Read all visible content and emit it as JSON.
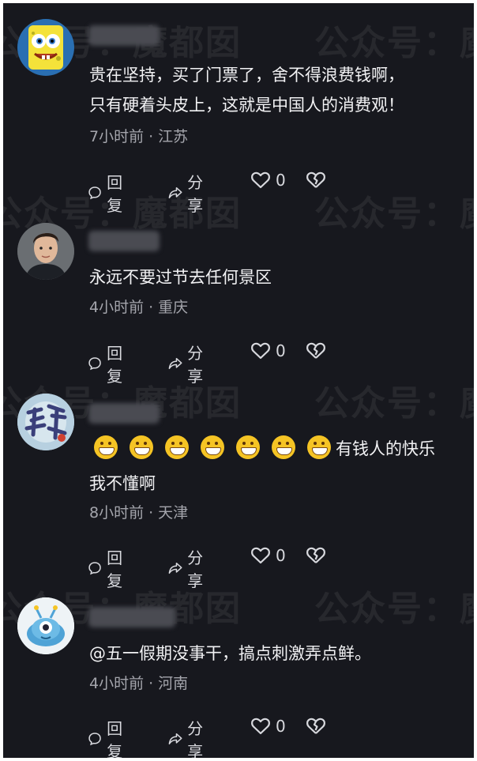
{
  "watermark": "公众号：魔都囡",
  "comments": [
    {
      "avatar_icon": "spongebob-avatar",
      "text_lines": [
        "贵在坚持，买了门票了，舍不得浪费钱啊，",
        "只有硬着头皮上，这就是中国人的消费观！"
      ],
      "time": "7小时前",
      "location": "江苏",
      "reply": "回复",
      "share": "分享",
      "likes": "0"
    },
    {
      "avatar_icon": "man-portrait-avatar",
      "text_lines": [
        "永远不要过节去任何景区"
      ],
      "time": "4小时前",
      "location": "重庆",
      "reply": "回复",
      "share": "分享",
      "likes": "0"
    },
    {
      "avatar_icon": "calligraphy-avatar",
      "emoji_count": 7,
      "text_lines": [
        "有钱人的快乐",
        "我不懂啊"
      ],
      "time": "8小时前",
      "location": "天津",
      "reply": "回复",
      "share": "分享",
      "likes": "0"
    },
    {
      "avatar_icon": "cartoon-alien-avatar",
      "text_lines": [
        "@五一假期没事干，搞点刺激弄点鲜。"
      ],
      "time": "4小时前",
      "location": "河南",
      "reply": "回复",
      "share": "分享",
      "likes": "0"
    }
  ],
  "colors": {
    "background": "#17181e",
    "text": "#f2f2f4",
    "meta": "#a4a5ac",
    "emoji": "#f5c424"
  }
}
